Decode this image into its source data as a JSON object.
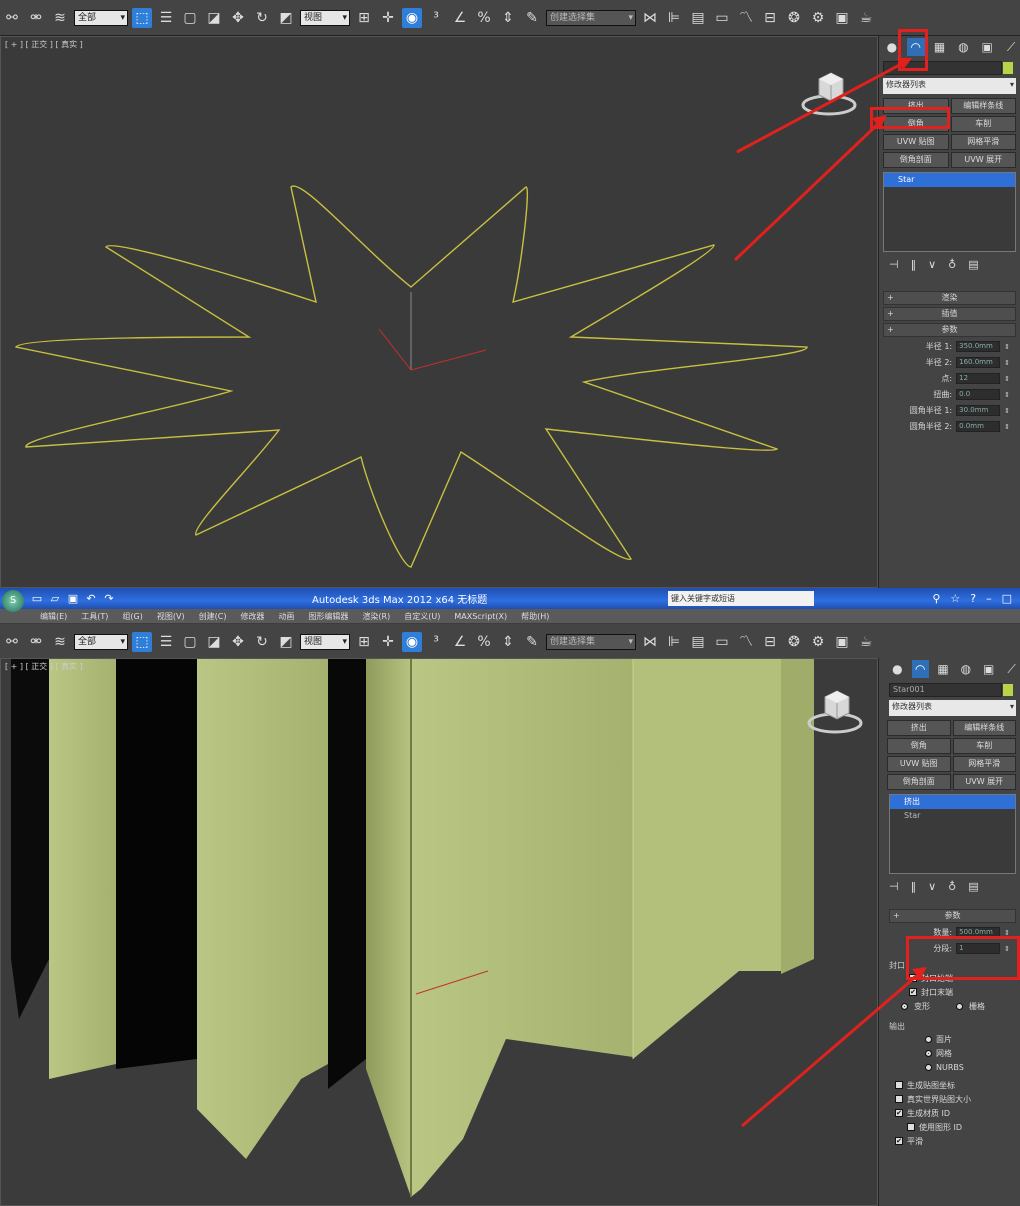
{
  "top": {
    "toolbar": {
      "selection_filter": "全部",
      "ref_coord": "视图",
      "named_selection": "创建选择集"
    },
    "viewport_label": "[ + ] [ 正交 ] [ 真实 ]",
    "command_panel": {
      "modifier_list": "修改器列表",
      "buttons": [
        "挤出",
        "编辑样条线",
        "倒角",
        "车削",
        "UVW 贴图",
        "网格平滑",
        "倒角剖面",
        "UVW 展开"
      ],
      "stack_item": "Star",
      "rollouts": [
        "渲染",
        "插值",
        "参数"
      ],
      "params": [
        {
          "label": "半径 1:",
          "value": "350.0mm"
        },
        {
          "label": "半径 2:",
          "value": "160.0mm"
        },
        {
          "label": "点:",
          "value": "12"
        },
        {
          "label": "扭曲:",
          "value": "0.0"
        },
        {
          "label": "圆角半径 1:",
          "value": "30.0mm"
        },
        {
          "label": "圆角半径 2:",
          "value": "0.0mm"
        }
      ]
    }
  },
  "bottom": {
    "titlebar": {
      "title": "Autodesk 3ds Max 2012 x64   无标题",
      "search_placeholder": "键入关键字或短语"
    },
    "menus": [
      "编辑(E)",
      "工具(T)",
      "组(G)",
      "视图(V)",
      "创建(C)",
      "修改器",
      "动画",
      "图形编辑器",
      "渲染(R)",
      "自定义(U)",
      "MAXScript(X)",
      "帮助(H)"
    ],
    "toolbar": {
      "selection_filter": "全部",
      "ref_coord": "视图",
      "named_selection": "创建选择集"
    },
    "viewport_label": "[ + ] [ 正交 ] [ 真实 ]",
    "command_panel": {
      "object_name": "Star001",
      "modifier_list": "修改器列表",
      "buttons": [
        "挤出",
        "编辑样条线",
        "倒角",
        "车削",
        "UVW 贴图",
        "网格平滑",
        "倒角剖面",
        "UVW 展开"
      ],
      "stack_items": [
        "挤出",
        "Star"
      ],
      "rollout_title": "参数",
      "params": [
        {
          "label": "数量:",
          "value": "500.0mm"
        },
        {
          "label": "分段:",
          "value": "1"
        }
      ],
      "capping_title": "封口",
      "capping": [
        "封口始端",
        "封口末端"
      ],
      "cap_types": [
        "变形",
        "栅格"
      ],
      "output_title": "输出",
      "output": [
        "面片",
        "网格",
        "NURBS"
      ],
      "checks": [
        "生成贴图坐标",
        "真实世界贴图大小",
        "生成材质 ID",
        "使用图形 ID",
        "平滑"
      ]
    }
  },
  "colors": {
    "highlight": "#e0211d",
    "star_outline": "#c8c040",
    "extrude_fill": "#b5c27e",
    "selection_blue": "#2e6fd8"
  }
}
